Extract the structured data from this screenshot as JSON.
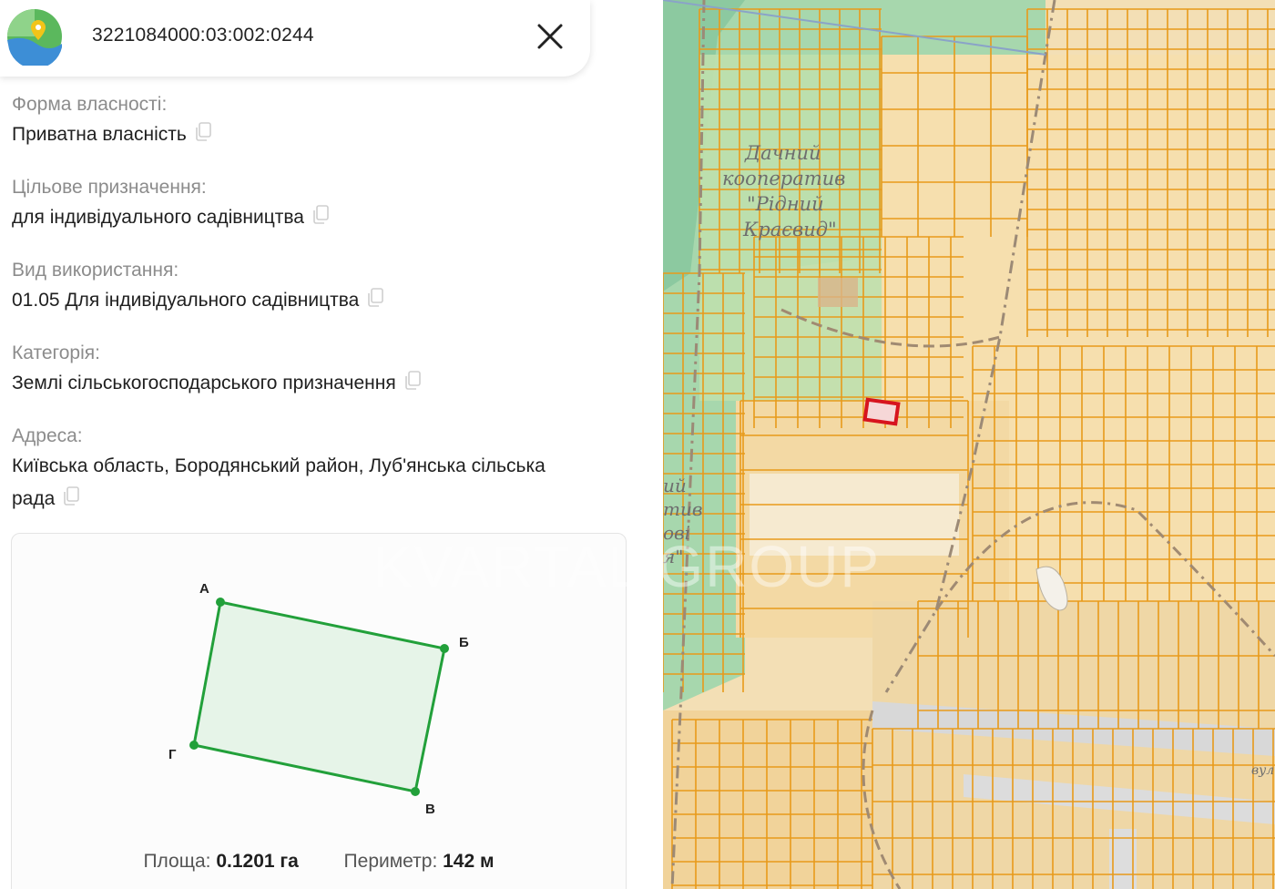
{
  "header": {
    "cadastral_number": "3221084000:03:002:0244",
    "logo_icon": "map-pin-logo-icon",
    "close_icon": "close-icon"
  },
  "fields": [
    {
      "label": "Форма власності:",
      "value": "Приватна власність"
    },
    {
      "label": "Цільове призначення:",
      "value": "для індивідуального садівництва"
    },
    {
      "label": "Вид використання:",
      "value": "01.05 Для індивідуального садівництва"
    },
    {
      "label": "Категорія:",
      "value": "Землі сільськогосподарського призначення"
    },
    {
      "label": "Адреса:",
      "value_line1": "Київська область, Бородянський район, Луб'янська сільська",
      "value_line2": "рада"
    }
  ],
  "plot": {
    "vertices": [
      "А",
      "Б",
      "В",
      "Г"
    ],
    "area_label": "Площа:",
    "area_value": "0.1201 га",
    "perimeter_label": "Периметр:",
    "perimeter_value": "142 м",
    "stroke_color": "#22a03a",
    "fill_color": "#e6f4e8"
  },
  "map": {
    "labels": [
      "Дачний",
      "кооператив",
      "\"Рідний",
      "Краєвид\""
    ],
    "edge_labels": [
      "ий",
      "тив",
      "ові",
      "я\""
    ],
    "watermark": "KVARTAL GROUP",
    "street_fragment": "вул",
    "parcel_color": "#e89a1a",
    "selected_color": "#d7141e"
  }
}
